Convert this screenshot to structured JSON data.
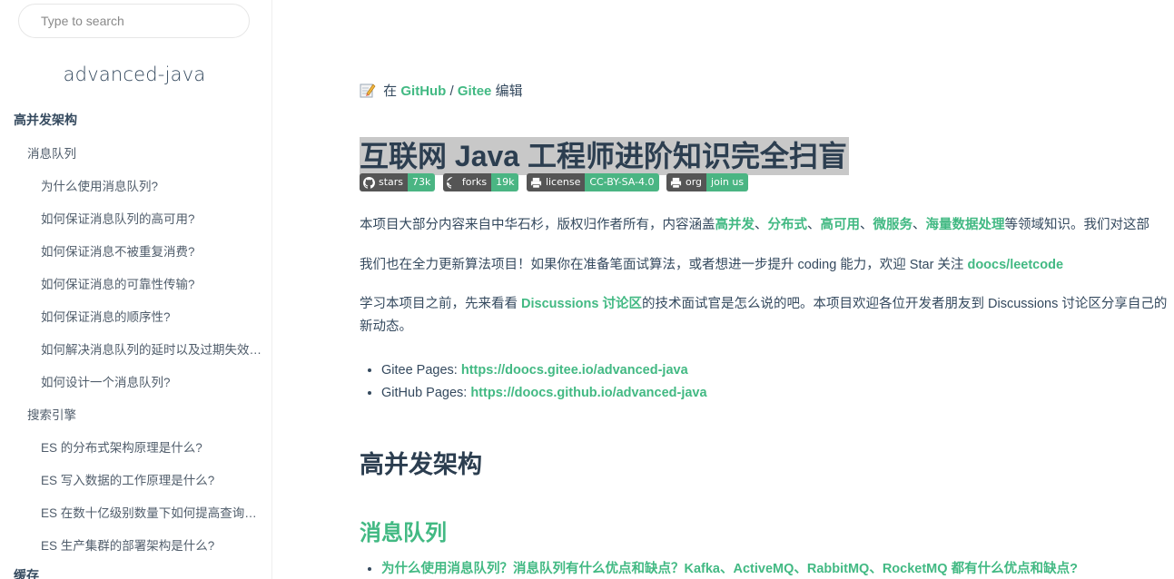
{
  "search": {
    "placeholder": "Type to search"
  },
  "sidebar": {
    "app_name": "advanced-java",
    "items": [
      {
        "label": "高并发架构",
        "level": 0
      },
      {
        "label": "消息队列",
        "level": 1
      },
      {
        "label": "为什么使用消息队列?",
        "level": 2
      },
      {
        "label": "如何保证消息队列的高可用?",
        "level": 2
      },
      {
        "label": "如何保证消息不被重复消费?",
        "level": 2
      },
      {
        "label": "如何保证消息的可靠性传输?",
        "level": 2
      },
      {
        "label": "如何保证消息的顺序性?",
        "level": 2
      },
      {
        "label": "如何解决消息队列的延时以及过期失效问题?",
        "level": 2
      },
      {
        "label": "如何设计一个消息队列?",
        "level": 2
      },
      {
        "label": "搜索引擎",
        "level": 1
      },
      {
        "label": "ES 的分布式架构原理是什么?",
        "level": 2
      },
      {
        "label": "ES 写入数据的工作原理是什么?",
        "level": 2
      },
      {
        "label": "ES 在数十亿级别数量下如何提高查询效率?",
        "level": 2
      },
      {
        "label": "ES 生产集群的部署架构是什么?",
        "level": 2
      },
      {
        "label": "缓存",
        "level": 0
      }
    ]
  },
  "main": {
    "edit": {
      "prefix": "在",
      "github": "GitHub",
      "sep": "/",
      "gitee": "Gitee",
      "suffix": "编辑"
    },
    "title": "互联网 Java 工程师进阶知识完全扫盲",
    "badges": [
      {
        "icon": "github-icon",
        "label": "stars",
        "value": "73k",
        "value_color": "#4ab583"
      },
      {
        "icon": "github-icon",
        "label": "forks",
        "value": "19k",
        "value_color": "#4ab583"
      },
      {
        "icon": "printer-icon",
        "label": "license",
        "value": "CC-BY-SA-4.0",
        "value_color": "#4ab583"
      },
      {
        "icon": "printer-icon",
        "label": "org",
        "value": "join us",
        "value_color": "#4ab583"
      }
    ],
    "intro": {
      "p1_text": "本项目大部分内容来自中华石杉，版权归作者所有，内容涵盖",
      "p1_links": [
        "高并发",
        "分布式",
        "高可用",
        "微服务",
        "海量数据处理"
      ],
      "p1_sep": "、",
      "p1_tail": "等领域知识。我们对这部",
      "p2_text": "我们也在全力更新算法项目！如果你在准备笔面试算法，或者想进一步提升 coding 能力，欢迎 Star 关注 ",
      "p2_link": "doocs/leetcode",
      "p3_pre": "学习本项目之前，先来看看 ",
      "p3_link": "Discussions 讨论区",
      "p3_text": "的技术面试官是怎么说的吧。本项目欢迎各位开发者朋友到 Discussions 讨论区分享自己的",
      "p3_line2": "新动态。"
    },
    "pages": [
      {
        "label": "Gitee Pages: ",
        "url": "https://doocs.gitee.io/advanced-java"
      },
      {
        "label": "GitHub Pages: ",
        "url": "https://doocs.github.io/advanced-java"
      }
    ],
    "section_title": "高并发架构",
    "subsection_title": "消息队列",
    "faq_link": "为什么使用消息队列？消息队列有什么优点和缺点？Kafka、ActiveMQ、RabbitMQ、RocketMQ 都有什么优点和缺点?"
  },
  "colors": {
    "accent": "#42b983",
    "text": "#34495e",
    "heading": "#2c3e50",
    "badge_dark": "#555555"
  }
}
